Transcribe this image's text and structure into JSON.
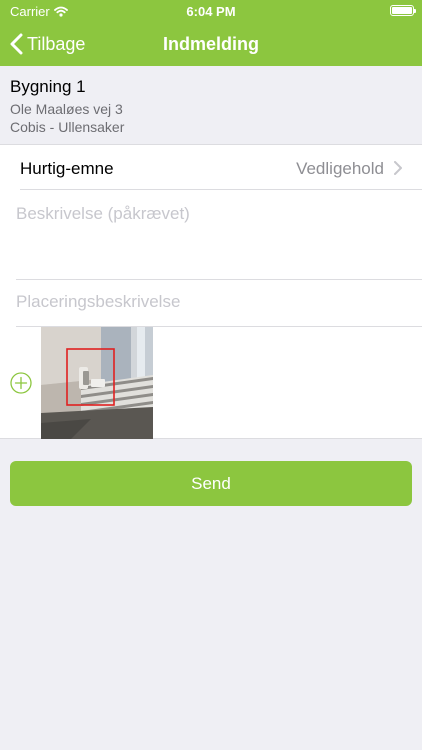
{
  "status_bar": {
    "carrier": "Carrier",
    "time": "6:04 PM"
  },
  "nav": {
    "back_label": "Tilbage",
    "title": "Indmelding"
  },
  "building": {
    "name": "Bygning 1",
    "address": "Ole Maaløes vej 3",
    "location": "Cobis - Ullensaker"
  },
  "form": {
    "topic_label": "Hurtig-emne",
    "topic_value": "Vedligehold",
    "description_placeholder": "Beskrivelse (påkrævet)",
    "location_placeholder": "Placeringsbeskrivelse"
  },
  "send_label": "Send",
  "colors": {
    "accent": "#8cc63f",
    "background": "#efeff4",
    "placeholder": "#c7c7cd",
    "marker": "#e02020"
  },
  "icons": [
    "wifi-icon",
    "battery-icon",
    "chevron-left-icon",
    "chevron-right-icon",
    "add-circle-icon"
  ]
}
